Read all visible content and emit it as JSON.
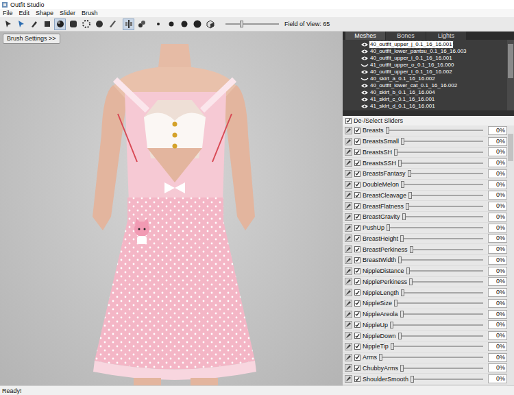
{
  "window": {
    "title": "Outfit Studio"
  },
  "menu": [
    "File",
    "Edit",
    "Shape",
    "Slider",
    "Brush"
  ],
  "toolbar": {
    "tools": [
      {
        "kind": "select",
        "selected": false
      },
      {
        "kind": "move",
        "selected": false
      },
      {
        "kind": "brush",
        "selected": false
      },
      {
        "kind": "mask",
        "selected": false
      },
      {
        "kind": "inflate",
        "selected": true
      },
      {
        "kind": "deflate",
        "selected": false
      },
      {
        "kind": "smooth",
        "selected": false
      },
      {
        "kind": "sphere",
        "selected": false
      },
      {
        "kind": "pen",
        "selected": false
      },
      {
        "kind": "mirror",
        "selected": true
      },
      {
        "kind": "link",
        "selected": false
      },
      {
        "kind": "dot1",
        "selected": false
      },
      {
        "kind": "dot2",
        "selected": false
      },
      {
        "kind": "dot3",
        "selected": false
      },
      {
        "kind": "dot4",
        "selected": false
      },
      {
        "kind": "cube",
        "selected": false
      }
    ],
    "fov": {
      "label": "Field of View: 65",
      "level": 0.3
    }
  },
  "viewport": {
    "brush_button": "Brush Settings >>"
  },
  "tabs": [
    {
      "label": "Meshes",
      "selected": true
    },
    {
      "label": "Bones",
      "selected": false
    },
    {
      "label": "Lights",
      "selected": false
    }
  ],
  "meshes": [
    {
      "name": "40_outfit_upper_j_0.1_16_16.001",
      "visible": true,
      "selected": true
    },
    {
      "name": "40_outfit_lower_pantsu_0.1_16_16.003",
      "visible": true,
      "selected": false
    },
    {
      "name": "40_outfit_upper_i_0.1_16_16.001",
      "visible": true,
      "selected": false
    },
    {
      "name": "41_outfit_upper_o_0.1_16_16.000",
      "visible": false,
      "selected": false
    },
    {
      "name": "40_outfit_upper_l_0.1_16_16.002",
      "visible": true,
      "selected": false
    },
    {
      "name": "40_skirt_a_0.1_16_16.002",
      "visible": false,
      "selected": false
    },
    {
      "name": "40_outfit_lower_cat_0.1_16_16.002",
      "visible": true,
      "selected": false
    },
    {
      "name": "40_skirt_b_0.1_16_16.004",
      "visible": true,
      "selected": false
    },
    {
      "name": "41_skirt_c_0.1_16_16.001",
      "visible": true,
      "selected": false
    },
    {
      "name": "41_skirt_d_0.1_16_16.001",
      "visible": true,
      "selected": false
    }
  ],
  "sliders_header": {
    "label": "De-/Select Sliders",
    "checked": true
  },
  "sliders": [
    {
      "name": "Breasts",
      "checked": true,
      "level": 0,
      "reading": "0%"
    },
    {
      "name": "BreastsSmall",
      "checked": true,
      "level": 0,
      "reading": "0%"
    },
    {
      "name": "BreastsSH",
      "checked": true,
      "level": 0,
      "reading": "0%"
    },
    {
      "name": "BreastsSSH",
      "checked": true,
      "level": 0,
      "reading": "0%"
    },
    {
      "name": "BreastsFantasy",
      "checked": true,
      "level": 0,
      "reading": "0%"
    },
    {
      "name": "DoubleMelon",
      "checked": true,
      "level": 0,
      "reading": "0%"
    },
    {
      "name": "BreastCleavage",
      "checked": true,
      "level": 0,
      "reading": "0%"
    },
    {
      "name": "BreastFlatness",
      "checked": true,
      "level": 0,
      "reading": "0%"
    },
    {
      "name": "BreastGravity",
      "checked": true,
      "level": 0,
      "reading": "0%"
    },
    {
      "name": "PushUp",
      "checked": true,
      "level": 0,
      "reading": "0%"
    },
    {
      "name": "BreastHeight",
      "checked": true,
      "level": 0,
      "reading": "0%"
    },
    {
      "name": "BreastPerkiness",
      "checked": true,
      "level": 0,
      "reading": "0%"
    },
    {
      "name": "BreastWidth",
      "checked": true,
      "level": 0,
      "reading": "0%"
    },
    {
      "name": "NippleDistance",
      "checked": true,
      "level": 0,
      "reading": "0%"
    },
    {
      "name": "NipplePerkiness",
      "checked": true,
      "level": 0,
      "reading": "0%"
    },
    {
      "name": "NippleLength",
      "checked": true,
      "level": 0,
      "reading": "0%"
    },
    {
      "name": "NippleSize",
      "checked": true,
      "level": 0,
      "reading": "0%"
    },
    {
      "name": "NippleAreola",
      "checked": true,
      "level": 0,
      "reading": "0%"
    },
    {
      "name": "NippleUp",
      "checked": true,
      "level": 0,
      "reading": "0%"
    },
    {
      "name": "NippleDown",
      "checked": true,
      "level": 0,
      "reading": "0%"
    },
    {
      "name": "NippleTip",
      "checked": true,
      "level": 0,
      "reading": "0%"
    },
    {
      "name": "Arms",
      "checked": true,
      "level": 0,
      "reading": "0%"
    },
    {
      "name": "ChubbyArms",
      "checked": true,
      "level": 0,
      "reading": "0%"
    },
    {
      "name": "ShoulderSmooth",
      "checked": true,
      "level": 0,
      "reading": "0%"
    }
  ],
  "status_bar": {
    "text": "Ready!"
  }
}
